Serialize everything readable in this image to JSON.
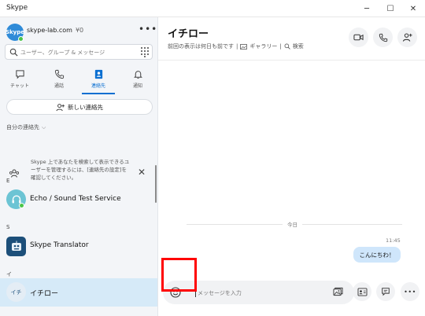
{
  "window": {
    "title": "Skype",
    "minimize_glyph": "─",
    "maximize_glyph": "☐",
    "close_glyph": "✕"
  },
  "account": {
    "avatar_text": "Skype",
    "name": "skype-lab.com",
    "credit": "¥0",
    "more_glyph": "•••"
  },
  "search": {
    "placeholder": "ユーザー、グループ & メッセージ"
  },
  "nav_tabs": [
    {
      "label": "チャット",
      "icon": "chat-icon"
    },
    {
      "label": "通話",
      "icon": "phone-icon"
    },
    {
      "label": "連絡先",
      "icon": "contacts-icon",
      "active": true
    },
    {
      "label": "通知",
      "icon": "bell-icon"
    }
  ],
  "new_contact": {
    "label": "新しい連絡先"
  },
  "my_contacts": {
    "header": "自分の連絡先",
    "chevron": "⌵"
  },
  "info_card": {
    "text": "Skype 上であなたを検索して表示できるユーザーを管理するには、[連絡先の設定]を確認してください。",
    "close_glyph": "✕"
  },
  "contact_groups": [
    {
      "letter": "E",
      "contacts": [
        {
          "name": "Echo / Sound Test Service",
          "online": true
        }
      ]
    },
    {
      "letter": "S",
      "contacts": [
        {
          "name": "Skype Translator"
        }
      ]
    },
    {
      "letter": "イ",
      "contacts": [
        {
          "name": "イチロー",
          "avatar_text": "イチ",
          "active": true
        }
      ]
    }
  ],
  "conversation": {
    "name": "イチロー",
    "last_seen": "前回の表示は何日も前です",
    "separator": "|",
    "gallery": "ギャラリー",
    "find": "検索",
    "date_divider": "今日",
    "message_time": "11:45",
    "message_text": "こんにちわ！"
  },
  "composer": {
    "placeholder": "メッセージを入力",
    "more_glyph": "•••"
  },
  "colors": {
    "accent": "#0b6fd1",
    "bubble": "#cfe6fb",
    "highlight": "#ff0000",
    "online": "#4bc54a",
    "selected_row": "#d6eaf8"
  }
}
